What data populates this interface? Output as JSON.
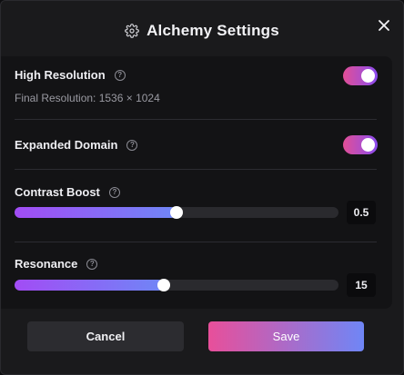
{
  "dialog": {
    "title": "Alchemy Settings",
    "title_icon": "gear-icon",
    "close_icon": "close-icon"
  },
  "settings": {
    "high_resolution": {
      "label": "High Resolution",
      "sub": "Final Resolution: 1536 × 1024",
      "enabled": true
    },
    "expanded_domain": {
      "label": "Expanded Domain",
      "enabled": true
    },
    "contrast_boost": {
      "label": "Contrast Boost",
      "value": "0.5",
      "fraction": 0.5
    },
    "resonance": {
      "label": "Resonance",
      "value": "15",
      "fraction": 0.46
    }
  },
  "help_glyph": "?",
  "buttons": {
    "cancel": "Cancel",
    "save": "Save"
  },
  "colors": {
    "accent_start": "#e24f96",
    "accent_end": "#6f86f6"
  }
}
